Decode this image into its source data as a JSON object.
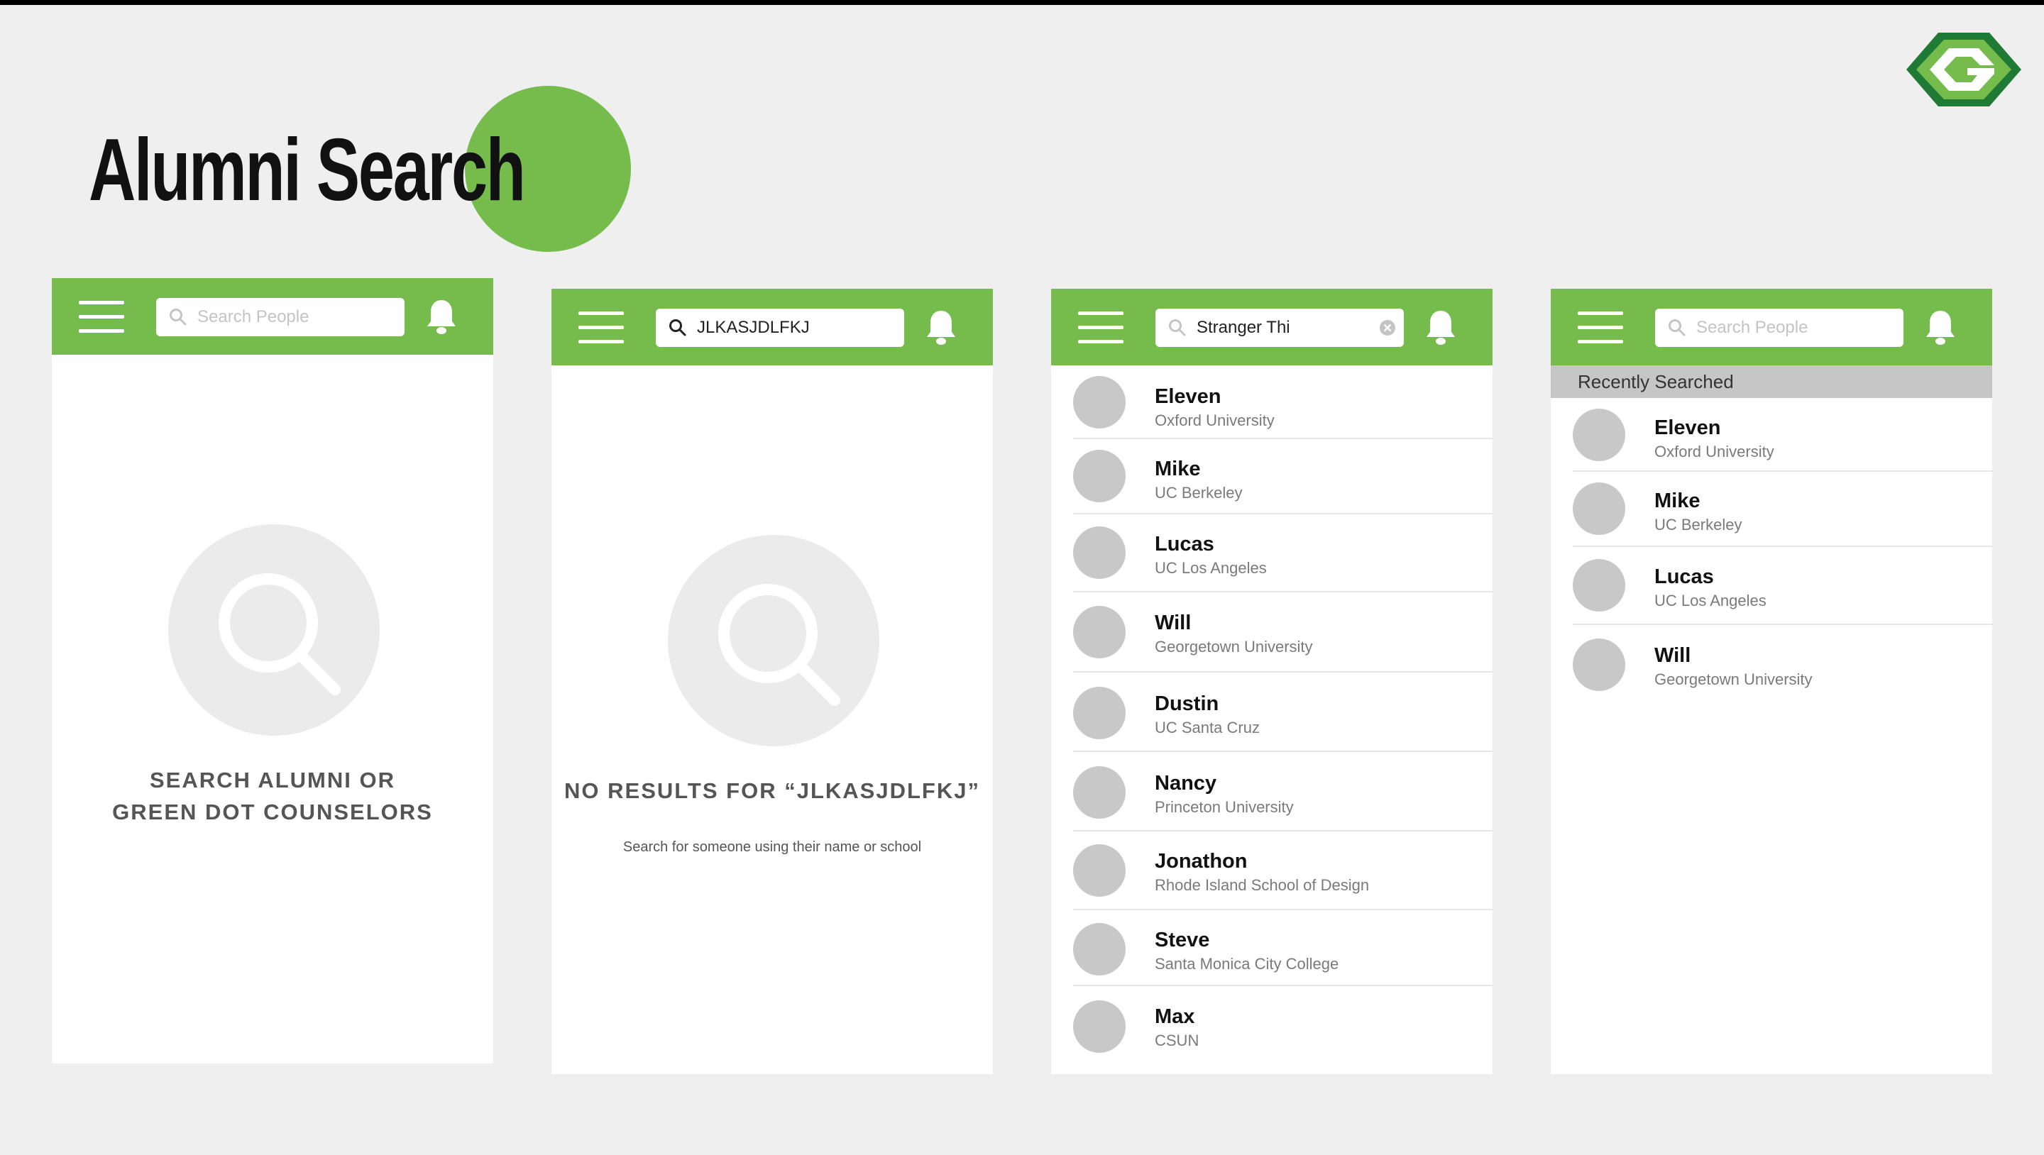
{
  "page": {
    "title": "Alumni Search"
  },
  "colors": {
    "accent": "#76bc4c",
    "background": "#efefef",
    "avatar": "#c8c8c8"
  },
  "screens": [
    {
      "search": {
        "value": "",
        "placeholder": "Search People"
      },
      "empty": {
        "title_line1": "SEARCH ALUMNI OR",
        "title_line2": "GREEN DOT COUNSELORS"
      }
    },
    {
      "search": {
        "value": "JLKASJDLFKJ",
        "placeholder": ""
      },
      "empty": {
        "title": "NO RESULTS FOR “JLKASJDLFKJ”",
        "subtitle": "Search for someone using their name or school"
      }
    },
    {
      "search": {
        "value": "Stranger Thi",
        "placeholder": ""
      },
      "results": [
        {
          "name": "Eleven",
          "school": "Oxford University"
        },
        {
          "name": "Mike",
          "school": "UC Berkeley"
        },
        {
          "name": "Lucas",
          "school": "UC Los Angeles"
        },
        {
          "name": "Will",
          "school": "Georgetown University"
        },
        {
          "name": "Dustin",
          "school": "UC Santa Cruz"
        },
        {
          "name": "Nancy",
          "school": "Princeton University"
        },
        {
          "name": "Jonathon",
          "school": "Rhode Island School of Design"
        },
        {
          "name": "Steve",
          "school": "Santa Monica City College"
        },
        {
          "name": "Max",
          "school": "CSUN"
        }
      ]
    },
    {
      "search": {
        "value": "",
        "placeholder": "Search People"
      },
      "recent_header": "Recently Searched",
      "recent": [
        {
          "name": "Eleven",
          "school": "Oxford University"
        },
        {
          "name": "Mike",
          "school": "UC Berkeley"
        },
        {
          "name": "Lucas",
          "school": "UC Los Angeles"
        },
        {
          "name": "Will",
          "school": "Georgetown University"
        }
      ]
    }
  ]
}
